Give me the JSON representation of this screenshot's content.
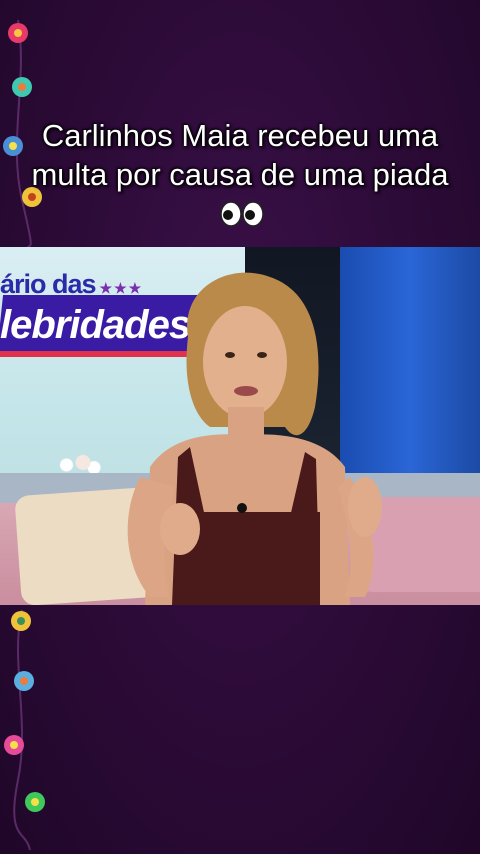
{
  "caption": {
    "text": "Carlinhos Maia recebeu uma multa por causa de uma piada",
    "emoji_icon": "eyes-emoji"
  },
  "video": {
    "logo_top": "ário das",
    "logo_stars": "★★★",
    "logo_main": "lebridades"
  },
  "colors": {
    "background": "#2a0a35",
    "caption_text": "#ffffff",
    "logo_band": "#3a1ca4"
  }
}
